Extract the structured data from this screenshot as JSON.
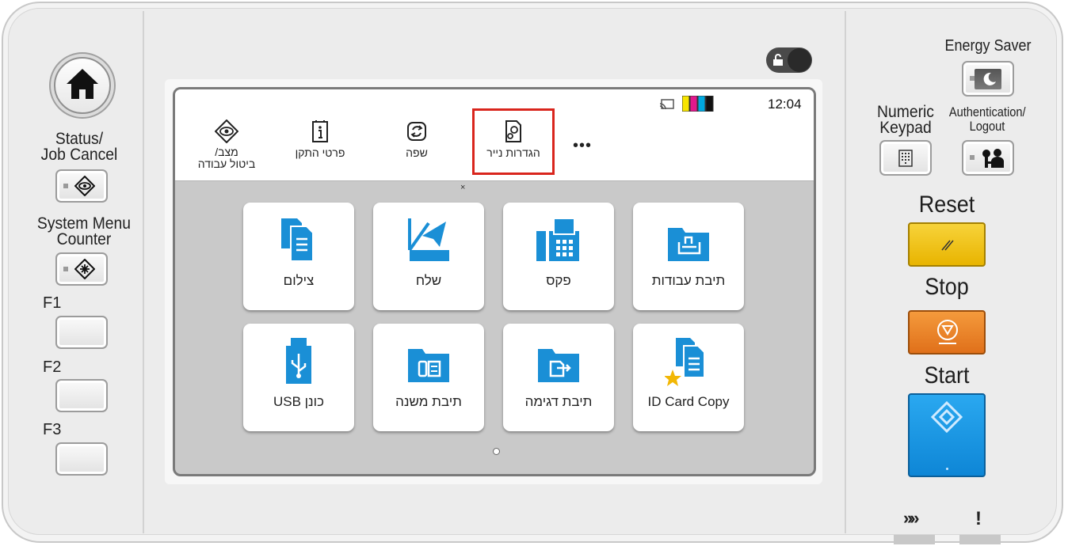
{
  "left_panel": {
    "status_label": "Status/\nJob Cancel",
    "system_menu_label": "System Menu\nCounter",
    "f1_label": "F1",
    "f2_label": "F2",
    "f3_label": "F3"
  },
  "right_panel": {
    "energy_saver_label": "Energy Saver",
    "numeric_keypad_label": "Numeric\nKeypad",
    "authentication_label": "Authentication/\nLogout",
    "reset_label": "Reset",
    "stop_label": "Stop",
    "start_label": "Start",
    "colors": {
      "reset": "#f2c200",
      "stop": "#ee7d1a",
      "start": "#1497e6"
    }
  },
  "screen": {
    "clock": "12:04",
    "top_items": [
      {
        "label": "מצב/\nביטול עבודה",
        "icon": "eye-diamond-icon"
      },
      {
        "label": "פרטי התקן",
        "icon": "device-info-icon"
      },
      {
        "label": "שפה",
        "icon": "language-icon"
      },
      {
        "label": "הגדרות נייר",
        "icon": "paper-settings-icon"
      }
    ],
    "more_label": "•••",
    "collapse_mark": "×",
    "tiles": [
      {
        "label": "צילום",
        "icon": "copy-icon"
      },
      {
        "label": "שלח",
        "icon": "send-icon"
      },
      {
        "label": "פקס",
        "icon": "fax-icon"
      },
      {
        "label": "תיבת עבודות",
        "icon": "job-box-icon"
      },
      {
        "label": "כונן USB",
        "icon": "usb-icon"
      },
      {
        "label": "תיבת משנה",
        "icon": "sub-address-box-icon"
      },
      {
        "label": "תיבת דגימה",
        "icon": "polling-box-icon"
      },
      {
        "label": "ID Card Copy",
        "icon": "id-card-copy-icon"
      }
    ],
    "highlight_color": "#d9251d",
    "icon_color": "#1a8fd6"
  },
  "bottom_indicators": {
    "processing": "»»",
    "attention": "!"
  }
}
